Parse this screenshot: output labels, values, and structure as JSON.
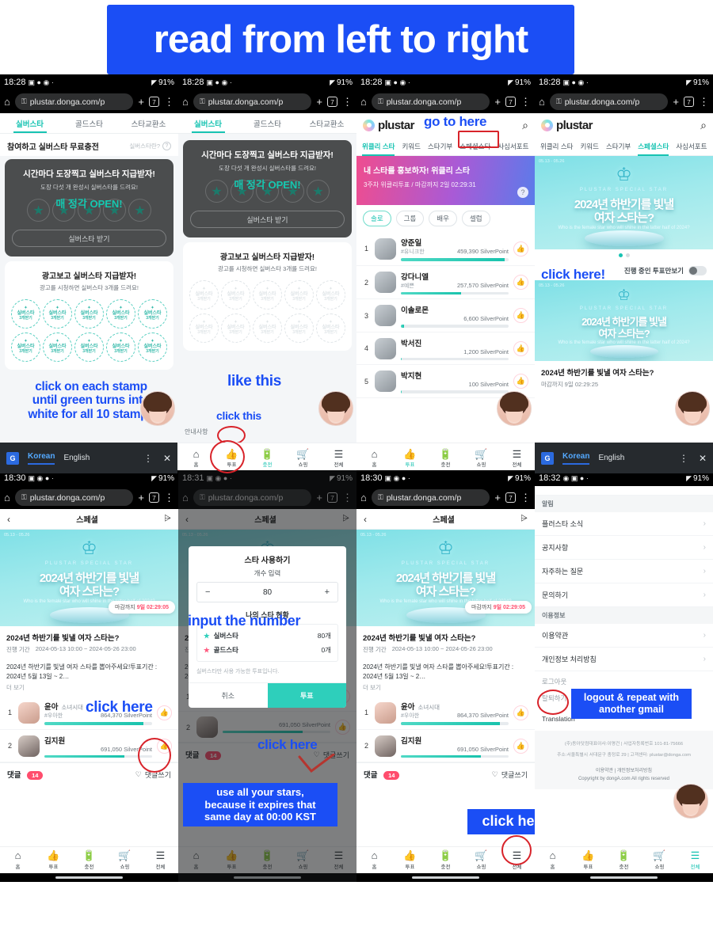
{
  "annotation_banner": {
    "text": "read from left to right",
    "color": "#1b4ef5"
  },
  "browser": {
    "url": "plustar.donga.com/p",
    "tab_count": "7",
    "plus_icon": "+",
    "menu_icon": "⋮",
    "home_icon": "⌂",
    "lock_icon": "⚿"
  },
  "status_bars": {
    "p1": {
      "time": "18:28",
      "battery": "91%"
    },
    "p2": {
      "time": "18:28",
      "battery": "91%"
    },
    "p3": {
      "time": "18:28",
      "battery": "91%"
    },
    "p4": {
      "time": "18:28",
      "battery": "91%"
    },
    "p5": {
      "time": "18:30",
      "battery": "91%"
    },
    "p6": {
      "time": "18:31",
      "battery": "91%"
    },
    "p7": {
      "time": "18:30",
      "battery": "91%"
    },
    "p8": {
      "time": "18:32",
      "battery": "91%"
    }
  },
  "translate_bar": {
    "icon_label": "G",
    "korean": "Korean",
    "english": "English",
    "menu_icon": "⋮",
    "close_icon": "✕"
  },
  "charge_page": {
    "tabs": [
      "실버스타",
      "골드스타",
      "스타교환소"
    ],
    "active_tab": "실버스타",
    "section_title": "참여하고 실버스타 무료충전",
    "help_label": "실버스타란?",
    "help_icon": "?",
    "stamp_card": {
      "title": "시간마다 도장찍고 실버스타 지급받자!",
      "subtitle": "도장 다섯 개 완성시 실버스타를 드려요!",
      "overlay": "매 정각 OPEN!",
      "button": "실버스타 받기",
      "star_icon": "★",
      "star_count": 5
    },
    "ad_card": {
      "title": "광고보고 실버스타 지급받자!",
      "subtitle": "광고를 시청하면 실버스타 3개를 드려요!",
      "stamp_line1": "실버스타",
      "stamp_line2": "3개받기",
      "stamp_count": 10
    },
    "notice_label": "안내사항"
  },
  "annotations": {
    "stamp_hint": "click on each stamp\nuntil green turns into\nwhite for all 10 stamps",
    "stamp_hint_lines": [
      "click on each stamp",
      "until green turns into",
      "white for all 10 stamps"
    ],
    "like_this": "like this",
    "click_this": "click this",
    "go_to_here": "go to here",
    "click_here_excl": "click here!",
    "click_here": "click here",
    "input_the_number": "input the number",
    "expire_note_lines": [
      "use all your stars,",
      "because it expires that",
      "same day at 00:00 KST"
    ],
    "logout_note_lines": [
      "logout & repeat with",
      "another gmail"
    ]
  },
  "plustar_app": {
    "logo_text": "plustar",
    "search_icon": "⌕",
    "nav": [
      "위클리 스타",
      "키워드",
      "스타기부",
      "스페셜스타",
      "사심서포트"
    ],
    "nav_active_p3": "위클리 스타",
    "nav_active_p4": "스페셜스타",
    "weekly_banner": {
      "title": "내 스타를 홍보하자! 위클리 스타",
      "subtitle": "3주차 위클리투표 / 마감까지 2일 02:29:31",
      "help_icon": "?"
    },
    "chips": [
      "솔로",
      "그룹",
      "배우",
      "셀럽"
    ],
    "chip_active": "솔로",
    "weekly_ranking": [
      {
        "rank": "1",
        "name": "양준일",
        "tag": "#유니크한",
        "points": "459,390 SilverPoint",
        "bar": 96
      },
      {
        "rank": "2",
        "name": "강다니엘",
        "tag": "#예쁜",
        "points": "257,570 SilverPoint",
        "bar": 56
      },
      {
        "rank": "3",
        "name": "이솔로몬",
        "tag": "",
        "points": "6,600 SilverPoint",
        "bar": 3
      },
      {
        "rank": "4",
        "name": "박서진",
        "tag": "",
        "points": "1,200 SilverPoint",
        "bar": 1
      },
      {
        "rank": "5",
        "name": "박지현",
        "tag": "",
        "points": "100 SilverPoint",
        "bar": 1
      }
    ]
  },
  "special_banner": {
    "date_range": "05.13 - 05.26",
    "kicker": "PLUSTAR SPECIAL STAR",
    "title_line1": "2024년 하반기를 빛낼",
    "title_line2": "여자 스타는?",
    "english": "Who is the female star who will shine in the latter half of 2024?",
    "crown_icon": "♔"
  },
  "special_list": {
    "toggle_label": "진행 중인 투표만보기",
    "card_title": "2024년 하반기를 빛낼 여자 스타는?",
    "card_deadline": "마감까지 9일 02:29:25"
  },
  "special_detail": {
    "header_title": "스페셜",
    "back_icon": "‹",
    "share_icon": "⩥",
    "deadline_pill_prefix": "마감까지",
    "deadline_pill_value": "9일 02:29:05",
    "title": "2024년 하반기를 빛낼 여자 스타는?",
    "period_label": "진행 기간",
    "period_value": "2024-05-13 10:00 ~ 2024-05-26 23:00",
    "description": "2024년 하반기를 빛낼 여자 스타를 뽑아주세요!투표기간 : 2024년 5월 13일 ~ 2…",
    "more": "더 보기",
    "ranking": [
      {
        "rank": "1",
        "name": "윤아",
        "group": "소녀시대",
        "tag": "#우아한",
        "points": "864,370 SilverPoint",
        "bar": 92
      },
      {
        "rank": "2",
        "name": "김지원",
        "group": "",
        "tag": "",
        "points": "691,050 SilverPoint",
        "bar": 74
      }
    ],
    "comment_label": "댓글",
    "comment_count": "14",
    "comment_write": "댓글쓰기",
    "comment_icon": "♡"
  },
  "vote_modal": {
    "title": "스타 사용하기",
    "count_label": "개수 입력",
    "minus": "−",
    "plus": "+",
    "value": "80",
    "status_label": "나의 스타 현황",
    "silver_label": "실버스타",
    "silver_value": "80개",
    "gold_label": "골드스타",
    "gold_value": "0개",
    "note": "실버스타만 사용 가능한 투표입니다.",
    "cancel": "취소",
    "confirm": "투표",
    "silver_icon": "★",
    "gold_icon": "★"
  },
  "settings": {
    "group_notice": "알림",
    "notice_items": [
      "플러스타 소식",
      "공지사항",
      "자주하는 질문",
      "문의하기"
    ],
    "group_info": "이용정보",
    "info_items": [
      "이용약관",
      "개인정보 처리방침"
    ],
    "logout": "로그아웃",
    "withdraw": "탈퇴하기",
    "translation": "Translation",
    "chevron": "›",
    "footer_line1": "(주)동아닷컴대표이사:이명건 | 사업자등록번호 101-81-75666",
    "footer_line2": "주소:서울특별시 서대문구 충정로 29 | 고객센터: plustar@donga.com",
    "footer_links": "이용약관  |  개인정보처리방침",
    "footer_copy": "Copyright by dongA.com All rights reserved"
  },
  "bottom_nav": {
    "items": [
      {
        "label": "홈",
        "icon": "⌂"
      },
      {
        "label": "투표",
        "icon": "👍"
      },
      {
        "label": "충전",
        "icon": "🔋"
      },
      {
        "label": "쇼핑",
        "icon": "🛒"
      },
      {
        "label": "전체",
        "icon": "☰"
      }
    ]
  }
}
